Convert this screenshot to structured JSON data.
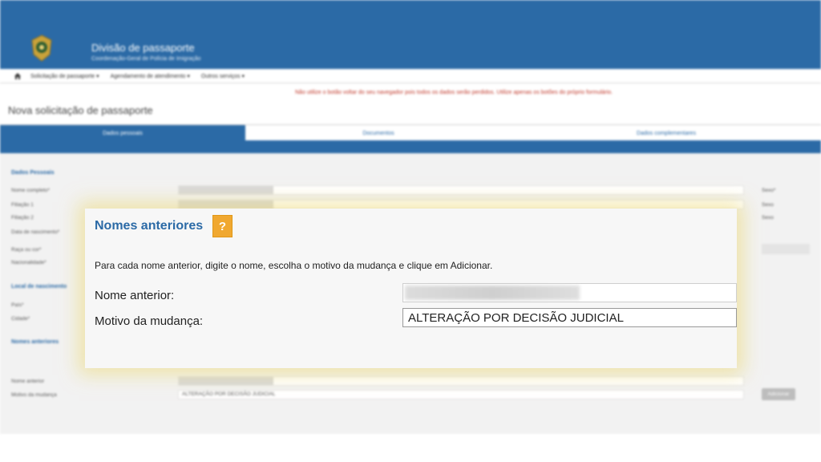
{
  "header": {
    "title": "Divisão de passaporte",
    "subtitle": "Coordenação-Geral de Polícia de Imigração"
  },
  "nav": {
    "items": [
      {
        "label": "Solicitação de passaporte ▾"
      },
      {
        "label": "Agendamento de atendimento ▾"
      },
      {
        "label": "Outros serviços ▾"
      }
    ]
  },
  "warning": "Não utilize o botão voltar do seu navegador pois todos os dados serão perdidos. Utilize apenas os botões do próprio formulário.",
  "page_title": "Nova solicitação de passaporte",
  "tabs": [
    {
      "label": "Dados pessoais"
    },
    {
      "label": "Documentos"
    },
    {
      "label": "Dados complementares"
    }
  ],
  "form": {
    "section_personal": "Dados Pessoais",
    "labels": {
      "nome": "Nome completo*",
      "filiacao1": "Filiação 1",
      "filiacao2": "Filiação 2",
      "nascimento": "Data de nascimento*",
      "raca": "Raça ou cor*",
      "nacionalidade": "Nacionalidade*"
    },
    "section_birthplace": "Local de nascimento",
    "labels_birth": {
      "pais": "País*",
      "cidade": "Cidade*"
    },
    "section_previous": "Nomes anteriores",
    "previous_instr": "Para cada nome anterior, digite o nome, escolha o motivo da mudança e clique em Adicionar.",
    "nome_anterior_label": "Nome anterior",
    "motivo_label": "Motivo da mudança",
    "motivo_value": "ALTERAÇÃO POR DECISÃO JUDICIAL",
    "right_labels": {
      "sexo1": "Sexo*",
      "sexo2": "Sexo",
      "sexo3": "Sexo"
    },
    "add_button": "Adicionar"
  },
  "dialog": {
    "title": "Nomes anteriores",
    "help": "?",
    "instruction": "Para cada nome anterior, digite o nome, escolha o motivo da mudança e clique em Adicionar.",
    "nome_anterior_label": "Nome anterior:",
    "motivo_label": "Motivo da mudança:",
    "motivo_value": "ALTERAÇÃO POR DECISÃO JUDICIAL"
  },
  "colors": {
    "primary": "#2b6aa6",
    "warning": "#c0392b",
    "help": "#f0a830",
    "glow": "#ebd76e"
  }
}
